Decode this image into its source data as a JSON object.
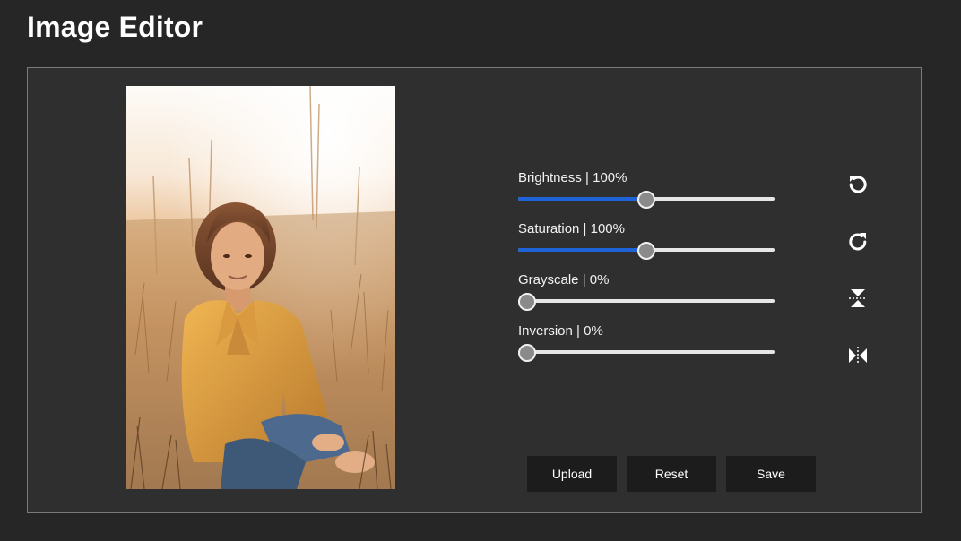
{
  "app": {
    "title": "Image Editor"
  },
  "filters": [
    {
      "name": "Brightness",
      "label": "Brightness | 100%",
      "value": 100,
      "max": 200
    },
    {
      "name": "Saturation",
      "label": "Saturation | 100%",
      "value": 100,
      "max": 200
    },
    {
      "name": "Grayscale",
      "label": "Grayscale | 0%",
      "value": 0,
      "max": 100
    },
    {
      "name": "Inversion",
      "label": "Inversion | 0%",
      "value": 0,
      "max": 100
    }
  ],
  "tools": [
    {
      "name": "rotate-left",
      "icon": "rotate-left-icon"
    },
    {
      "name": "rotate-right",
      "icon": "rotate-right-icon"
    },
    {
      "name": "flip-vertical",
      "icon": "flip-vertical-icon"
    },
    {
      "name": "flip-horizontal",
      "icon": "flip-horizontal-icon"
    }
  ],
  "actions": {
    "upload_label": "Upload",
    "reset_label": "Reset",
    "save_label": "Save"
  },
  "colors": {
    "background": "#262626",
    "panel": "#2f2f2f",
    "slider_fill": "#1e63d8",
    "button": "#1c1c1c"
  }
}
